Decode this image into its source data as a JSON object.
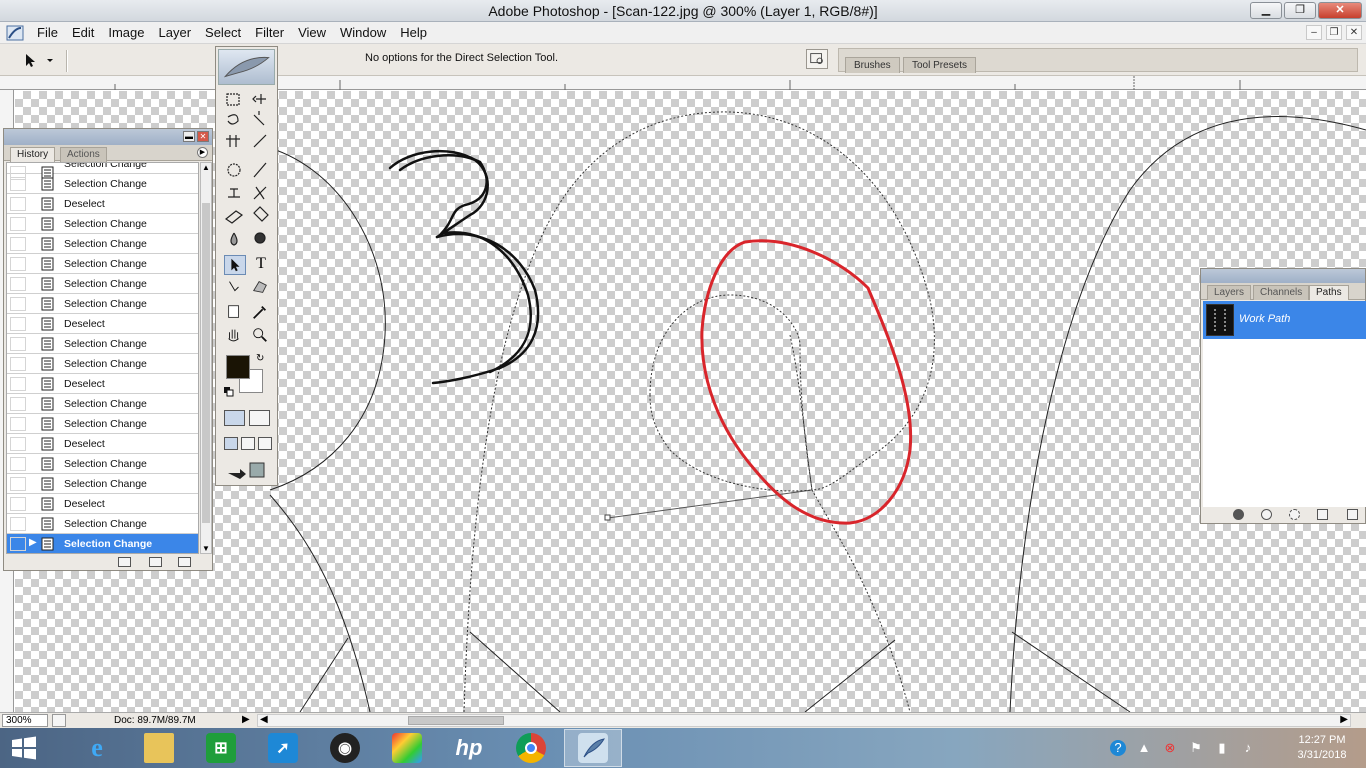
{
  "window": {
    "title": "Adobe Photoshop - [Scan-122.jpg @ 300% (Layer 1, RGB/8#)]",
    "minimize": "▁",
    "restore": "❐",
    "close": "✕"
  },
  "menu": [
    "File",
    "Edit",
    "Image",
    "Layer",
    "Select",
    "Filter",
    "View",
    "Window",
    "Help"
  ],
  "options_bar": {
    "message": "No options for the Direct Selection Tool.",
    "palette_well_tabs": [
      "Brushes",
      "Tool Presets"
    ]
  },
  "history_panel": {
    "tabs": [
      "History",
      "Actions"
    ],
    "active_tab": "History",
    "items": [
      "Selection Change",
      "Selection Change",
      "Deselect",
      "Selection Change",
      "Selection Change",
      "Selection Change",
      "Selection Change",
      "Selection Change",
      "Deselect",
      "Selection Change",
      "Selection Change",
      "Deselect",
      "Selection Change",
      "Selection Change",
      "Deselect",
      "Selection Change",
      "Selection Change",
      "Deselect",
      "Selection Change",
      "Selection Change"
    ],
    "current_item": "Selection Change"
  },
  "paths_panel": {
    "tabs": [
      "Layers",
      "Channels",
      "Paths"
    ],
    "active_tab": "Paths",
    "paths": [
      "Work Path"
    ]
  },
  "status_bar": {
    "zoom": "300%",
    "doc_size": "Doc: 89.7M/89.7M"
  },
  "taskbar": {
    "time": "12:27 PM",
    "date": "3/31/2018",
    "apps": [
      "internet-explorer",
      "file-explorer",
      "store",
      "rocket-app",
      "camera-app",
      "paint-app",
      "hp-app",
      "chrome",
      "photoshop"
    ],
    "active_app": "photoshop"
  },
  "colors": {
    "highlight": "#3b86e8",
    "red_stroke": "#d9252b",
    "foreground_color": "#1a1405"
  }
}
